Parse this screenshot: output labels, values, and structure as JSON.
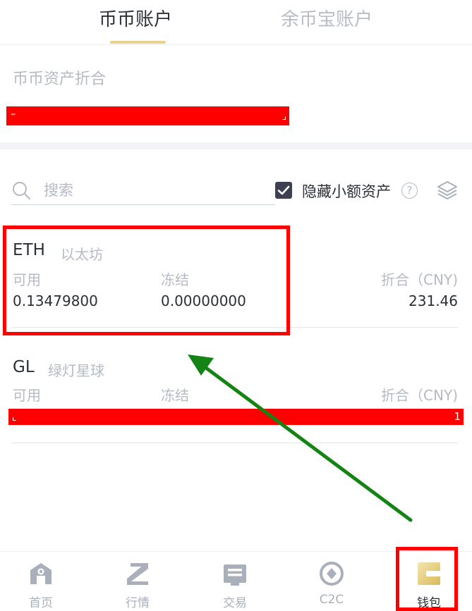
{
  "tabs": [
    {
      "label": "币币账户",
      "active": true
    },
    {
      "label": "余币宝账户",
      "active": false
    }
  ],
  "asset_summary": {
    "label": "币币资产折合",
    "value_redacted": true
  },
  "search": {
    "placeholder": "搜索",
    "hide_small_label": "隐藏小额资产",
    "hide_small_checked": true
  },
  "coins": [
    {
      "symbol": "ETH",
      "name": "以太坊",
      "available_label": "可用",
      "frozen_label": "冻结",
      "equiv_label": "折合（CNY)",
      "available": "0.13479800",
      "frozen": "0.00000000",
      "equiv": "231.46"
    },
    {
      "symbol": "GL",
      "name": "绿灯星球",
      "available_label": "可用",
      "frozen_label": "冻结",
      "equiv_label": "折合（CNY)",
      "values_redacted": true,
      "redact_mark_right": "1"
    }
  ],
  "nav": [
    {
      "label": "首页",
      "icon": "home-icon",
      "active": false
    },
    {
      "label": "行情",
      "icon": "market-icon",
      "active": false
    },
    {
      "label": "交易",
      "icon": "trade-icon",
      "active": false
    },
    {
      "label": "C2C",
      "icon": "c2c-icon",
      "active": false
    },
    {
      "label": "钱包",
      "icon": "wallet-icon",
      "active": true
    }
  ],
  "colors": {
    "accent": "#e9d38a",
    "annotation_red": "#ff0000",
    "annotation_arrow": "#138413",
    "text_primary": "#2b2f36",
    "text_secondary": "#b6bac4"
  }
}
